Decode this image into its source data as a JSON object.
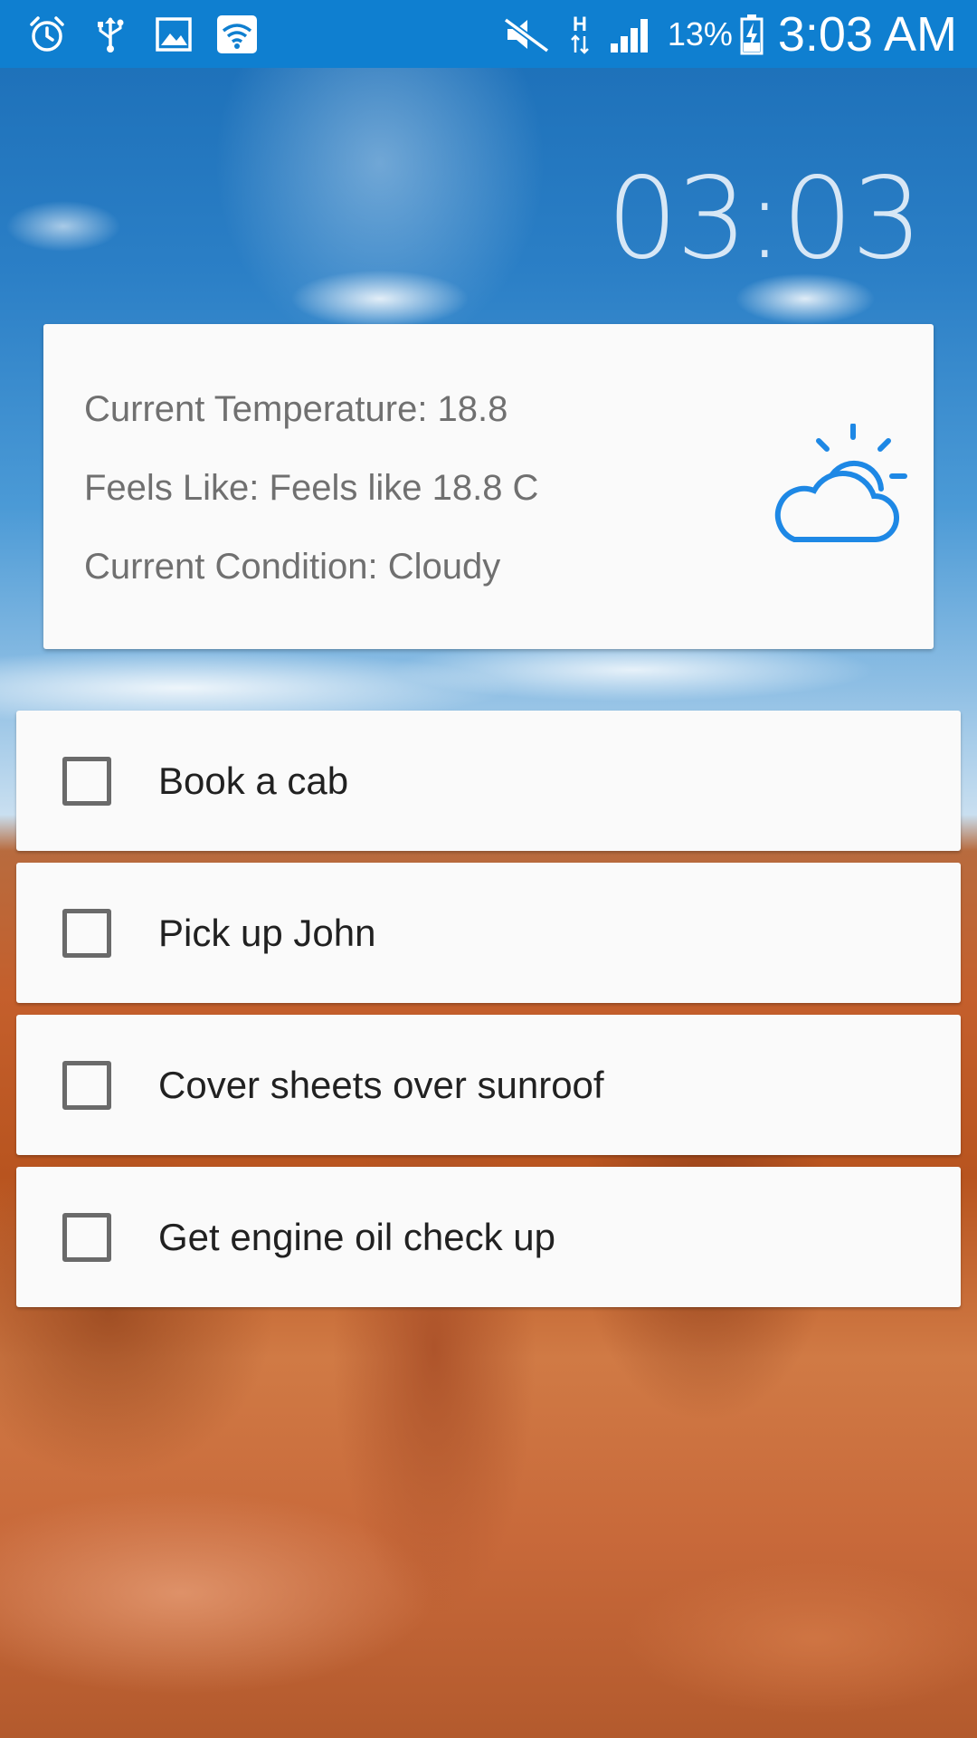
{
  "status_bar": {
    "left_icons": [
      "alarm-icon",
      "usb-icon",
      "image-icon",
      "wifi-icon"
    ],
    "right_icons": [
      "mute-icon",
      "h-data-icon",
      "signal-icon"
    ],
    "battery_percent": "13%",
    "time": "3:03 AM",
    "background_color": "#0f7fd0"
  },
  "clock": {
    "time": "03:03"
  },
  "weather": {
    "temperature_line": "Current Temperature: 18.8",
    "feels_like_line": "Feels Like: Feels like 18.8 C",
    "condition_line": "Current Condition: Cloudy",
    "icon": "partly-cloudy-icon",
    "icon_color": "#1e88e5"
  },
  "todos": [
    {
      "label": "Book a cab",
      "checked": false
    },
    {
      "label": "Pick up John",
      "checked": false
    },
    {
      "label": "Cover sheets over sunroof",
      "checked": false
    },
    {
      "label": "Get engine oil check up",
      "checked": false
    }
  ]
}
